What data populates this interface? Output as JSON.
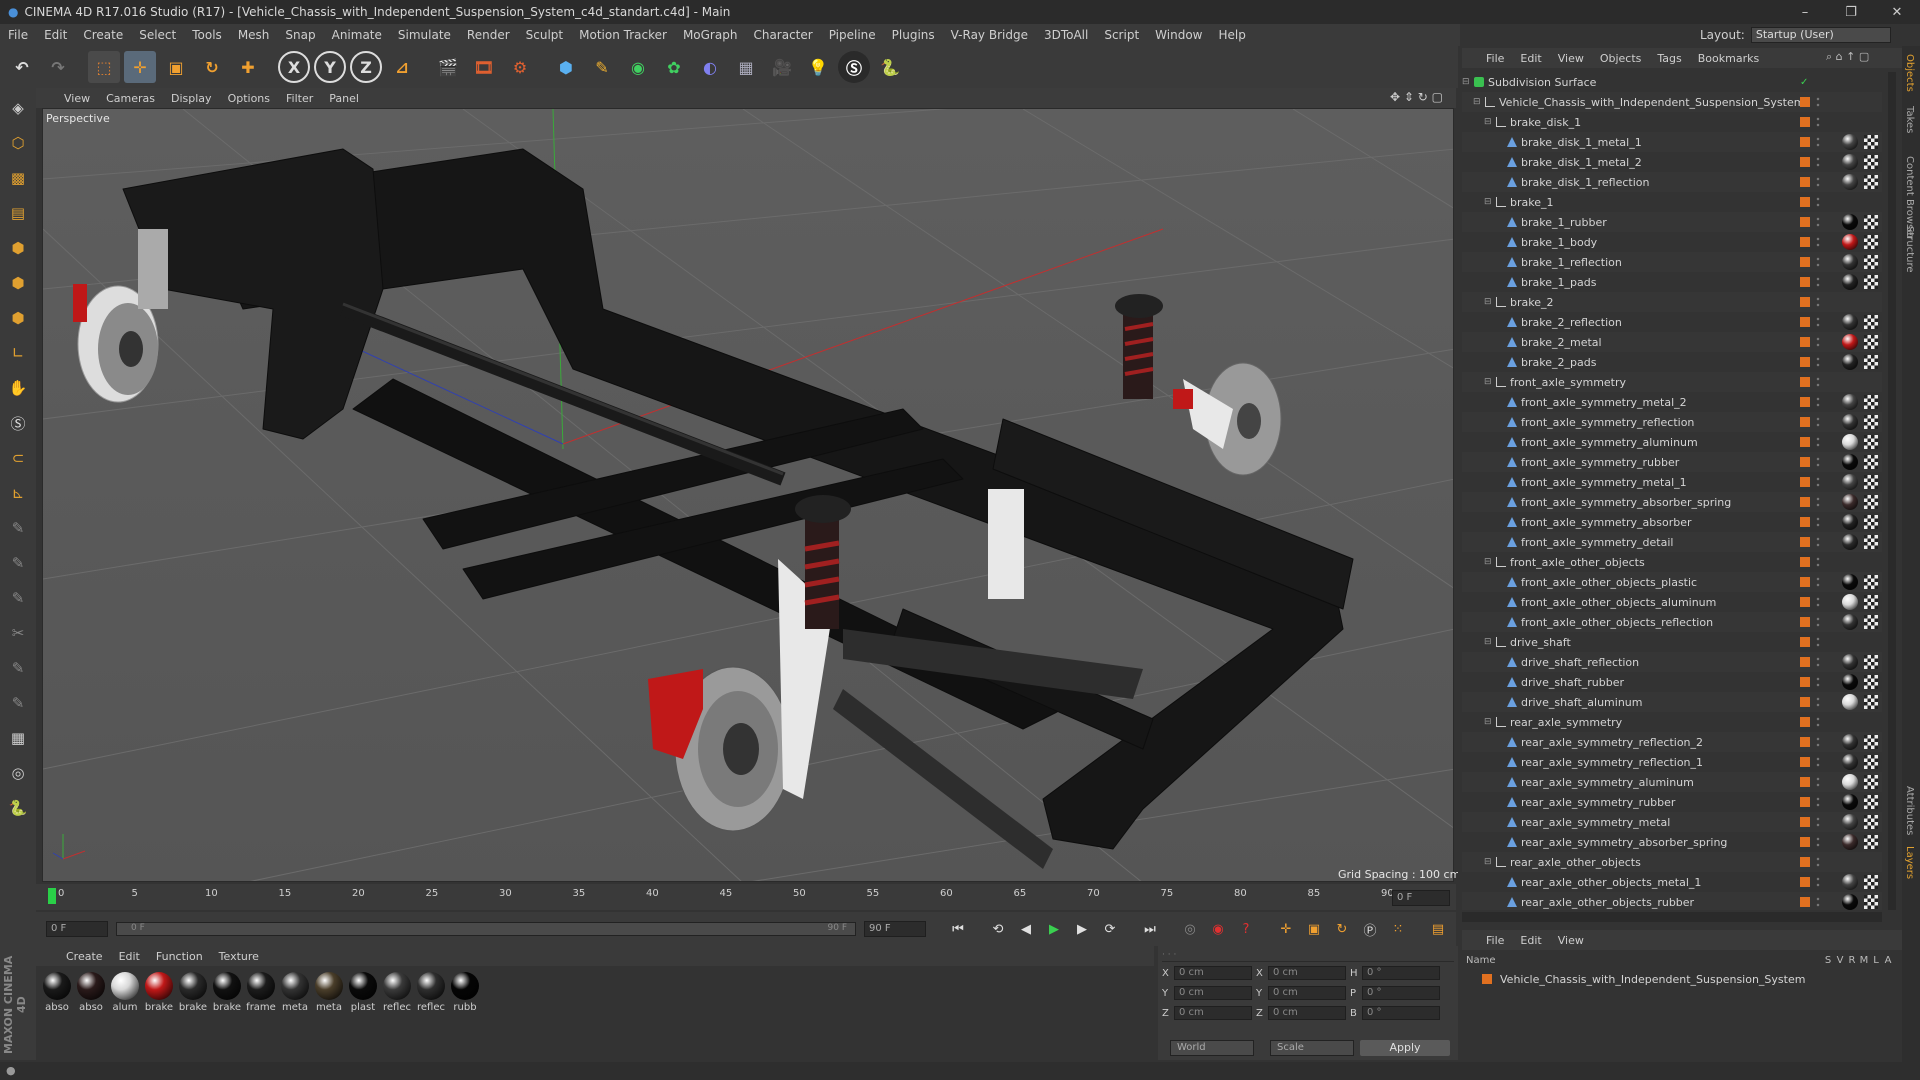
{
  "window": {
    "title": "CINEMA 4D R17.016 Studio (R17) - [Vehicle_Chassis_with_Independent_Suspension_System_c4d_standart.c4d] - Main",
    "controls": [
      "–",
      "❐",
      "✕"
    ]
  },
  "menu": [
    "File",
    "Edit",
    "Create",
    "Select",
    "Tools",
    "Mesh",
    "Snap",
    "Animate",
    "Simulate",
    "Render",
    "Sculpt",
    "Motion Tracker",
    "MoGraph",
    "Character",
    "Pipeline",
    "Plugins",
    "V-Ray Bridge",
    "3DToAll",
    "Script",
    "Window",
    "Help"
  ],
  "layout": {
    "label": "Layout:",
    "value": "Startup (User)"
  },
  "toolbar_icons": [
    "undo-icon",
    "redo-icon",
    "live-selection-icon",
    "move-icon",
    "scale-icon",
    "rotate-icon",
    "world-move-icon",
    "x-axis-icon",
    "y-axis-icon",
    "z-axis-icon",
    "coordinate-system-icon",
    "render-view-icon",
    "render-picture-viewer-icon",
    "edit-render-settings-icon",
    "cube-icon",
    "pen-icon",
    "subdivision-icon",
    "array-icon",
    "deformer-icon",
    "floor-icon",
    "camera-icon",
    "light-icon",
    "vray-icon",
    "python-icon"
  ],
  "toolbar_axis_labels": [
    "X",
    "Y",
    "Z"
  ],
  "viewport": {
    "menu": [
      "View",
      "Cameras",
      "Display",
      "Options",
      "Filter",
      "Panel"
    ],
    "label": "Perspective",
    "grid_spacing": "Grid Spacing : 100 cm"
  },
  "timeline": {
    "ticks": [
      "0",
      "5",
      "10",
      "15",
      "20",
      "25",
      "30",
      "35",
      "40",
      "45",
      "50",
      "55",
      "60",
      "65",
      "70",
      "75",
      "80",
      "85",
      "90"
    ],
    "current_frame_right": "0 F",
    "start_field": "0 F",
    "range_field": "0 F",
    "range_end_field": "90 F",
    "end_field": "90 F"
  },
  "materials": {
    "menu": [
      "Create",
      "Edit",
      "Function",
      "Texture"
    ],
    "items": [
      {
        "label": "abso",
        "color": "#1a1a1a"
      },
      {
        "label": "abso",
        "color": "#2a1a1a"
      },
      {
        "label": "alum",
        "color": "#d8d8d8"
      },
      {
        "label": "brake",
        "color": "#c01818"
      },
      {
        "label": "brake",
        "color": "#2a2a2a"
      },
      {
        "label": "brake",
        "color": "#111111"
      },
      {
        "label": "frame",
        "color": "#1c1c1c"
      },
      {
        "label": "meta",
        "color": "#333333"
      },
      {
        "label": "meta",
        "color": "#4a3e2a"
      },
      {
        "label": "plast",
        "color": "#0a0a0a"
      },
      {
        "label": "reflec",
        "color": "#3a3a3a"
      },
      {
        "label": "reflec",
        "color": "#2e2e2e"
      },
      {
        "label": "rubb",
        "color": "#050505"
      }
    ]
  },
  "coordinates": {
    "rows": [
      {
        "a": "X",
        "av": "0 cm",
        "b": "X",
        "bv": "0 cm",
        "c": "H",
        "cv": "0 °"
      },
      {
        "a": "Y",
        "av": "0 cm",
        "b": "Y",
        "bv": "0 cm",
        "c": "P",
        "cv": "0 °"
      },
      {
        "a": "Z",
        "av": "0 cm",
        "b": "Z",
        "bv": "0 cm",
        "c": "B",
        "cv": "0 °"
      }
    ],
    "space": "World",
    "mode": "Scale",
    "apply": "Apply"
  },
  "object_manager": {
    "menu": [
      "File",
      "Edit",
      "View",
      "Objects",
      "Tags",
      "Bookmarks"
    ],
    "objects": [
      {
        "name": "Subdivision Surface",
        "depth": 0,
        "type": "subdiv",
        "mat": ""
      },
      {
        "name": "Vehicle_Chassis_with_Independent_Suspension_System",
        "depth": 1,
        "type": "null",
        "mat": ""
      },
      {
        "name": "brake_disk_1",
        "depth": 2,
        "type": "null",
        "mat": ""
      },
      {
        "name": "brake_disk_1_metal_1",
        "depth": 3,
        "type": "mesh",
        "mat": "#444444"
      },
      {
        "name": "brake_disk_1_metal_2",
        "depth": 3,
        "type": "mesh",
        "mat": "#444444"
      },
      {
        "name": "brake_disk_1_reflection",
        "depth": 3,
        "type": "mesh",
        "mat": "#444444"
      },
      {
        "name": "brake_1",
        "depth": 2,
        "type": "null",
        "mat": ""
      },
      {
        "name": "brake_1_rubber",
        "depth": 3,
        "type": "mesh",
        "mat": "#0a0a0a"
      },
      {
        "name": "brake_1_body",
        "depth": 3,
        "type": "mesh",
        "mat": "#c01818"
      },
      {
        "name": "brake_1_reflection",
        "depth": 3,
        "type": "mesh",
        "mat": "#333333"
      },
      {
        "name": "brake_1_pads",
        "depth": 3,
        "type": "mesh",
        "mat": "#222222"
      },
      {
        "name": "brake_2",
        "depth": 2,
        "type": "null",
        "mat": ""
      },
      {
        "name": "brake_2_reflection",
        "depth": 3,
        "type": "mesh",
        "mat": "#333333"
      },
      {
        "name": "brake_2_metal",
        "depth": 3,
        "type": "mesh",
        "mat": "#c01818"
      },
      {
        "name": "brake_2_pads",
        "depth": 3,
        "type": "mesh",
        "mat": "#222222"
      },
      {
        "name": "front_axle_symmetry",
        "depth": 2,
        "type": "null",
        "mat": ""
      },
      {
        "name": "front_axle_symmetry_metal_2",
        "depth": 3,
        "type": "mesh",
        "mat": "#444444"
      },
      {
        "name": "front_axle_symmetry_reflection",
        "depth": 3,
        "type": "mesh",
        "mat": "#333333"
      },
      {
        "name": "front_axle_symmetry_aluminum",
        "depth": 3,
        "type": "mesh",
        "mat": "#d8d8d8"
      },
      {
        "name": "front_axle_symmetry_rubber",
        "depth": 3,
        "type": "mesh",
        "mat": "#0a0a0a"
      },
      {
        "name": "front_axle_symmetry_metal_1",
        "depth": 3,
        "type": "mesh",
        "mat": "#444444"
      },
      {
        "name": "front_axle_symmetry_absorber_spring",
        "depth": 3,
        "type": "mesh",
        "mat": "#3a2a2a"
      },
      {
        "name": "front_axle_symmetry_absorber",
        "depth": 3,
        "type": "mesh",
        "mat": "#222222"
      },
      {
        "name": "front_axle_symmetry_detail",
        "depth": 3,
        "type": "mesh",
        "mat": "#2a2a2a"
      },
      {
        "name": "front_axle_other_objects",
        "depth": 2,
        "type": "null",
        "mat": ""
      },
      {
        "name": "front_axle_other_objects_plastic",
        "depth": 3,
        "type": "mesh",
        "mat": "#0a0a0a"
      },
      {
        "name": "front_axle_other_objects_aluminum",
        "depth": 3,
        "type": "mesh",
        "mat": "#d8d8d8"
      },
      {
        "name": "front_axle_other_objects_reflection",
        "depth": 3,
        "type": "mesh",
        "mat": "#333333"
      },
      {
        "name": "drive_shaft",
        "depth": 2,
        "type": "null",
        "mat": ""
      },
      {
        "name": "drive_shaft_reflection",
        "depth": 3,
        "type": "mesh",
        "mat": "#333333"
      },
      {
        "name": "drive_shaft_rubber",
        "depth": 3,
        "type": "mesh",
        "mat": "#0a0a0a"
      },
      {
        "name": "drive_shaft_aluminum",
        "depth": 3,
        "type": "mesh",
        "mat": "#d8d8d8"
      },
      {
        "name": "rear_axle_symmetry",
        "depth": 2,
        "type": "null",
        "mat": ""
      },
      {
        "name": "rear_axle_symmetry_reflection_2",
        "depth": 3,
        "type": "mesh",
        "mat": "#333333"
      },
      {
        "name": "rear_axle_symmetry_reflection_1",
        "depth": 3,
        "type": "mesh",
        "mat": "#333333"
      },
      {
        "name": "rear_axle_symmetry_aluminum",
        "depth": 3,
        "type": "mesh",
        "mat": "#d8d8d8"
      },
      {
        "name": "rear_axle_symmetry_rubber",
        "depth": 3,
        "type": "mesh",
        "mat": "#0a0a0a"
      },
      {
        "name": "rear_axle_symmetry_metal",
        "depth": 3,
        "type": "mesh",
        "mat": "#444444"
      },
      {
        "name": "rear_axle_symmetry_absorber_spring",
        "depth": 3,
        "type": "mesh",
        "mat": "#3a2a2a"
      },
      {
        "name": "rear_axle_other_objects",
        "depth": 2,
        "type": "null",
        "mat": ""
      },
      {
        "name": "rear_axle_other_objects_metal_1",
        "depth": 3,
        "type": "mesh",
        "mat": "#444444"
      },
      {
        "name": "rear_axle_other_objects_rubber",
        "depth": 3,
        "type": "mesh",
        "mat": "#0a0a0a"
      }
    ]
  },
  "layer_manager": {
    "menu": [
      "File",
      "Edit",
      "View"
    ],
    "columns": [
      "Name",
      "S",
      "V",
      "R",
      "M",
      "L",
      "A"
    ],
    "row": "Vehicle_Chassis_with_Independent_Suspension_System"
  },
  "side_tabs": [
    "Objects",
    "Takes",
    "Content Browser",
    "Structure",
    "Attributes",
    "Layers"
  ],
  "brand": "MAXON CINEMA 4D"
}
